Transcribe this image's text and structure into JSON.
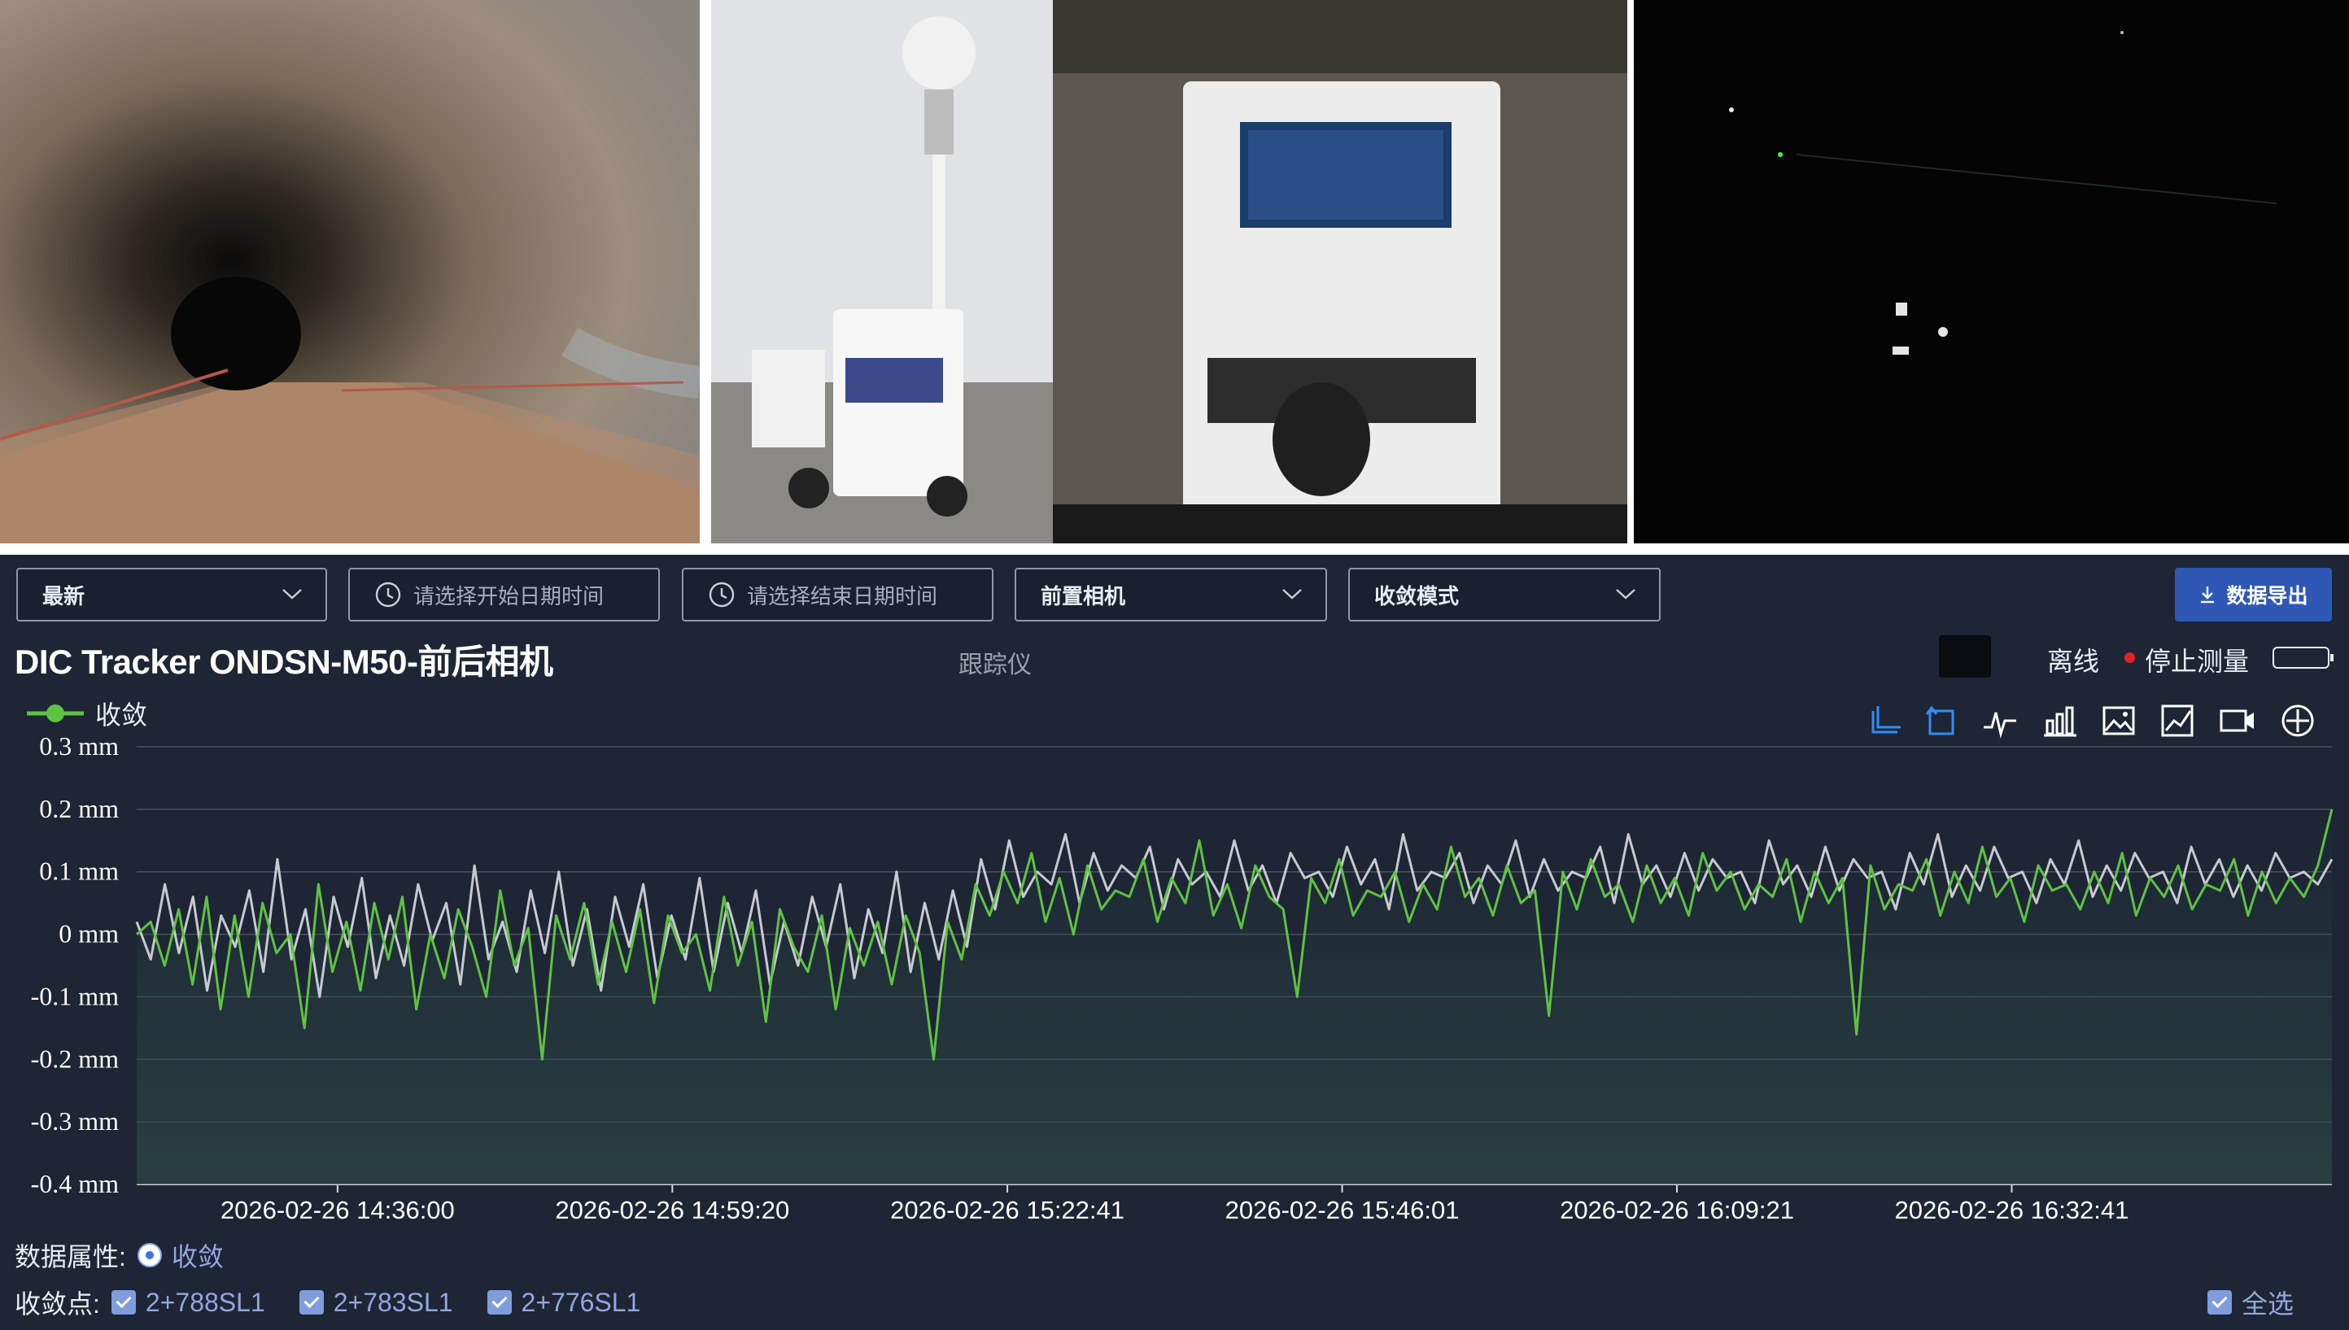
{
  "toolbar": {
    "filter_latest": "最新",
    "start_placeholder": "请选择开始日期时间",
    "end_placeholder": "请选择结束日期时间",
    "camera_select": "前置相机",
    "mode_select": "收敛模式",
    "export_label": "数据导出"
  },
  "header": {
    "title": "DIC Tracker ONDSN-M50-前后相机",
    "subtitle": "跟踪仪",
    "status_offline": "离线",
    "status_stop": "停止测量"
  },
  "legend": {
    "series_name": "收敛",
    "color": "#5ec242"
  },
  "chart_icons": [
    "crop-icon",
    "crop-back-icon",
    "line-chart-icon",
    "bar-chart-icon",
    "image-icon",
    "area-chart-icon",
    "video-icon",
    "crosshair-icon"
  ],
  "chart_data": {
    "type": "line",
    "ylabel_unit": "mm",
    "ylim": [
      -0.4,
      0.3
    ],
    "y_ticks": [
      "0.3 mm",
      "0.2 mm",
      "0.1 mm",
      "0 mm",
      "-0.1 mm",
      "-0.2 mm",
      "-0.3 mm",
      "-0.4 mm"
    ],
    "x_ticks": [
      "2026-02-26 14:36:00",
      "2026-02-26 14:59:20",
      "2026-02-26 15:22:41",
      "2026-02-26 15:46:01",
      "2026-02-26 16:09:21",
      "2026-02-26 16:32:41"
    ],
    "x_range": [
      "2026-02-26 14:22:00",
      "2026-02-26 16:55:00"
    ],
    "grid": true,
    "series": [
      {
        "name": "收敛",
        "color": "#5ec242",
        "values": [
          0.0,
          0.02,
          -0.05,
          0.04,
          -0.08,
          0.06,
          -0.12,
          0.03,
          -0.1,
          0.05,
          -0.03,
          0.0,
          -0.15,
          0.08,
          -0.06,
          0.02,
          -0.09,
          0.05,
          -0.04,
          0.06,
          -0.12,
          0.0,
          -0.07,
          0.04,
          -0.02,
          -0.1,
          0.07,
          -0.05,
          0.01,
          -0.2,
          0.03,
          -0.04,
          0.05,
          -0.08,
          0.02,
          -0.06,
          0.04,
          -0.11,
          0.03,
          -0.03,
          0.0,
          -0.09,
          0.06,
          -0.05,
          0.02,
          -0.14,
          0.04,
          -0.02,
          -0.06,
          0.03,
          -0.12,
          0.01,
          -0.05,
          0.02,
          -0.08,
          0.03,
          -0.03,
          -0.2,
          0.02,
          -0.04,
          0.08,
          0.03,
          0.1,
          0.05,
          0.13,
          0.02,
          0.09,
          0.0,
          0.11,
          0.04,
          0.07,
          0.06,
          0.12,
          0.02,
          0.09,
          0.05,
          0.15,
          0.03,
          0.08,
          0.01,
          0.11,
          0.06,
          0.04,
          -0.1,
          0.09,
          0.05,
          0.12,
          0.03,
          0.07,
          0.06,
          0.1,
          0.02,
          0.08,
          0.04,
          0.14,
          0.06,
          0.09,
          0.03,
          0.11,
          0.05,
          0.07,
          -0.13,
          0.1,
          0.04,
          0.12,
          0.06,
          0.08,
          0.02,
          0.11,
          0.05,
          0.09,
          0.03,
          0.13,
          0.07,
          0.1,
          0.04,
          0.08,
          0.06,
          0.12,
          0.02,
          0.1,
          0.05,
          0.09,
          -0.16,
          0.11,
          0.04,
          0.08,
          0.07,
          0.12,
          0.03,
          0.1,
          0.05,
          0.14,
          0.06,
          0.09,
          0.02,
          0.11,
          0.07,
          0.08,
          0.04,
          0.1,
          0.05,
          0.13,
          0.03,
          0.09,
          0.06,
          0.11,
          0.04,
          0.08,
          0.07,
          0.12,
          0.03,
          0.1,
          0.05,
          0.09,
          0.06,
          0.11,
          0.2
        ]
      },
      {
        "name": "",
        "color": "#c7c9d0",
        "values": [
          0.02,
          -0.04,
          0.08,
          -0.03,
          0.06,
          -0.09,
          0.03,
          -0.02,
          0.07,
          -0.06,
          0.12,
          -0.04,
          0.04,
          -0.1,
          0.06,
          -0.02,
          0.09,
          -0.07,
          0.03,
          -0.05,
          0.08,
          -0.01,
          0.05,
          -0.08,
          0.11,
          -0.04,
          0.02,
          -0.06,
          0.07,
          -0.03,
          0.1,
          -0.05,
          0.04,
          -0.09,
          0.06,
          -0.02,
          0.08,
          -0.07,
          0.03,
          -0.04,
          0.09,
          -0.06,
          0.05,
          -0.03,
          0.07,
          -0.08,
          0.02,
          -0.05,
          0.06,
          -0.02,
          0.08,
          -0.07,
          0.04,
          -0.03,
          0.1,
          -0.06,
          0.05,
          -0.04,
          0.07,
          -0.02,
          0.12,
          0.04,
          0.15,
          0.06,
          0.1,
          0.08,
          0.16,
          0.05,
          0.13,
          0.07,
          0.11,
          0.09,
          0.14,
          0.04,
          0.12,
          0.08,
          0.1,
          0.06,
          0.15,
          0.07,
          0.11,
          0.05,
          0.13,
          0.09,
          0.1,
          0.06,
          0.14,
          0.08,
          0.12,
          0.04,
          0.16,
          0.07,
          0.1,
          0.09,
          0.13,
          0.05,
          0.11,
          0.08,
          0.15,
          0.06,
          0.12,
          0.07,
          0.1,
          0.09,
          0.14,
          0.05,
          0.16,
          0.08,
          0.11,
          0.06,
          0.13,
          0.07,
          0.12,
          0.09,
          0.1,
          0.05,
          0.15,
          0.08,
          0.11,
          0.06,
          0.14,
          0.07,
          0.12,
          0.09,
          0.1,
          0.04,
          0.13,
          0.08,
          0.16,
          0.06,
          0.11,
          0.07,
          0.14,
          0.09,
          0.1,
          0.05,
          0.12,
          0.08,
          0.15,
          0.06,
          0.11,
          0.07,
          0.13,
          0.09,
          0.1,
          0.05,
          0.14,
          0.08,
          0.12,
          0.06,
          0.11,
          0.07,
          0.13,
          0.09,
          0.1,
          0.08,
          0.12
        ]
      }
    ]
  },
  "footer": {
    "attr_label": "数据属性:",
    "attr_value": "收敛",
    "points_label": "收敛点:",
    "points": [
      "2+788SL1",
      "2+783SL1",
      "2+776SL1"
    ],
    "select_all": "全选"
  }
}
